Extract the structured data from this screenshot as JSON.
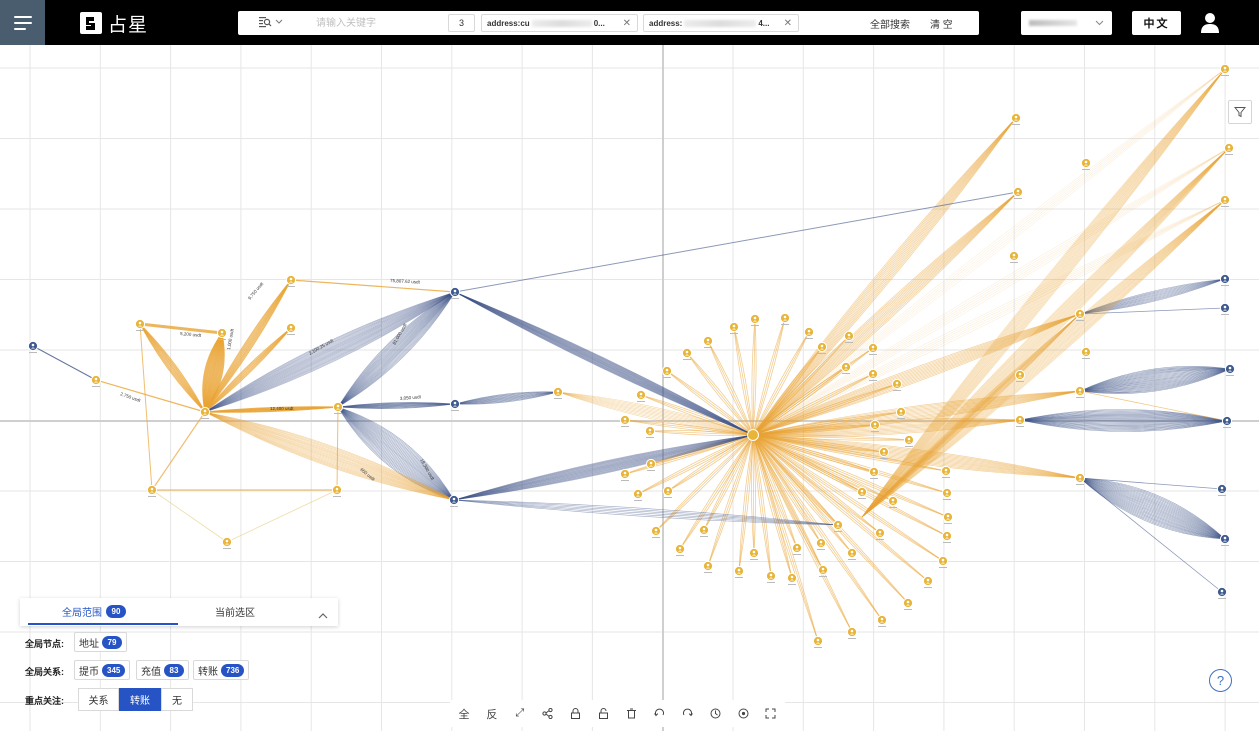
{
  "app": {
    "logo_text": "占星"
  },
  "search": {
    "mode_icon": "search-mode-icon",
    "placeholder": "请输入关键字",
    "depth": "3",
    "address_chips": [
      {
        "prefix": "address:cu",
        "suffix": "0..."
      },
      {
        "prefix": "address:",
        "suffix": "4..."
      }
    ],
    "search_all": "全部搜索",
    "clear": "清 空"
  },
  "lang": {
    "label": "中文"
  },
  "graph": {
    "colors": {
      "node_orange": "#e8b53a",
      "node_blue": "#3f5a8e",
      "edge_orange": "#e9a435",
      "edge_blue": "#3e5387",
      "grid": "#e6e6e6"
    },
    "edge_labels": [
      "75,807.62 usdt",
      "9,750 usdt",
      "2,100.25 usdt",
      "81,000 usdt",
      "1,000 usdt",
      "5,200 usdt",
      "12,400 usdt",
      "3,050 usdt",
      "650 usdt",
      "2,750 usdt",
      "18,300 usdt"
    ]
  },
  "panel": {
    "tabs": [
      {
        "label": "全局范围",
        "badge": "90"
      },
      {
        "label": "当前选区"
      }
    ],
    "nodes_label": "全局节点:",
    "nodes": [
      {
        "label": "地址",
        "count": "79"
      }
    ],
    "relations_label": "全局关系:",
    "relations": [
      {
        "label": "提币",
        "count": "345"
      },
      {
        "label": "充值",
        "count": "83"
      },
      {
        "label": "转账",
        "count": "736"
      }
    ],
    "focus_label": "重点关注:",
    "focus_options": [
      "关系",
      "转账",
      "无"
    ],
    "focus_selected": "转账"
  },
  "toolbar": {
    "tools": [
      {
        "name": "select-all-tool",
        "glyph": "全"
      },
      {
        "name": "invert-select-tool",
        "glyph": "反"
      },
      {
        "name": "expand-icon",
        "glyph": "⤢"
      },
      {
        "name": "share-icon",
        "glyph": "⋖"
      },
      {
        "name": "lock-icon",
        "glyph": "🔒"
      },
      {
        "name": "unlock-icon",
        "glyph": "🔓"
      },
      {
        "name": "delete-icon",
        "glyph": "🗑"
      },
      {
        "name": "undo-icon",
        "glyph": "↶"
      },
      {
        "name": "redo-icon",
        "glyph": "↷"
      },
      {
        "name": "history-icon",
        "glyph": "◷"
      },
      {
        "name": "locate-icon",
        "glyph": "⊕"
      },
      {
        "name": "fit-view-icon",
        "glyph": "⛶"
      }
    ]
  }
}
